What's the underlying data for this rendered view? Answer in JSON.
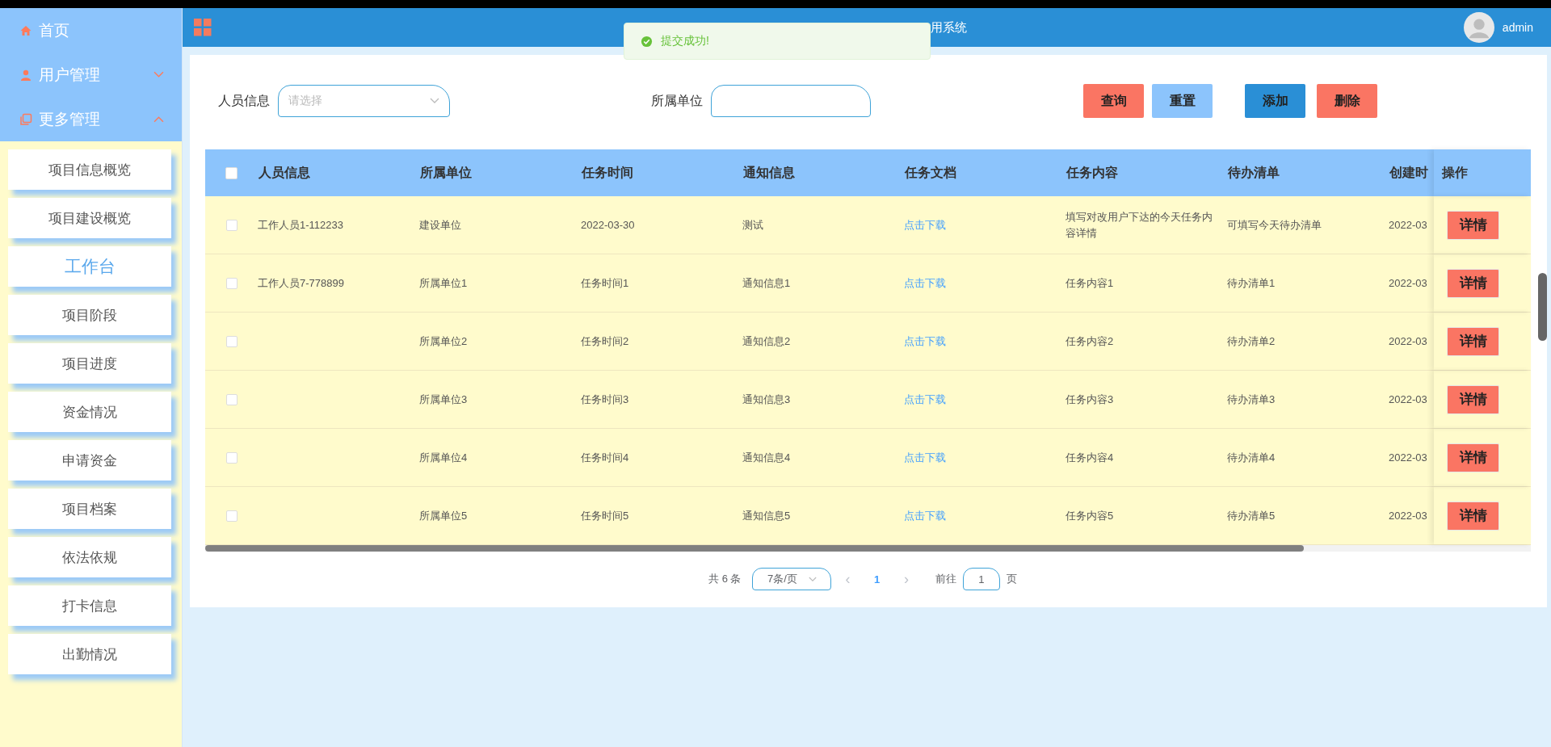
{
  "sidebar": {
    "menu": [
      {
        "label": "首页"
      },
      {
        "label": "用户管理",
        "expanded": false
      },
      {
        "label": "更多管理",
        "expanded": true
      }
    ],
    "submenu": [
      {
        "label": "项目信息概览",
        "selected": false
      },
      {
        "label": "项目建设概览",
        "selected": false
      },
      {
        "label": "工作台",
        "selected": true
      },
      {
        "label": "项目阶段",
        "selected": false
      },
      {
        "label": "项目进度",
        "selected": false
      },
      {
        "label": "资金情况",
        "selected": false
      },
      {
        "label": "申请资金",
        "selected": false
      },
      {
        "label": "项目档案",
        "selected": false
      },
      {
        "label": "依法依规",
        "selected": false
      },
      {
        "label": "打卡信息",
        "selected": false
      },
      {
        "label": "出勤情况",
        "selected": false
      }
    ]
  },
  "header": {
    "title": "用系统",
    "user": "admin"
  },
  "toast": {
    "message": "提交成功!"
  },
  "search": {
    "fields": [
      {
        "label": "人员信息",
        "kind": "select",
        "placeholder": "请选择"
      },
      {
        "label": "所属单位",
        "kind": "input"
      }
    ],
    "buttons": [
      {
        "label": "查询",
        "kind": "danger"
      },
      {
        "label": "重置",
        "kind": "light"
      },
      {
        "label": "添加",
        "kind": "primary"
      },
      {
        "label": "删除",
        "kind": "danger"
      }
    ]
  },
  "table": {
    "select_all_checked": false,
    "columns": [
      "人员信息",
      "所属单位",
      "任务时间",
      "通知信息",
      "任务文档",
      "任务内容",
      "待办清单",
      "创建时"
    ],
    "action_column": "操作",
    "rows": [
      {
        "checked": false,
        "cells": [
          "工作人员1-112233",
          "建设单位",
          "2022-03-30",
          "测试",
          "点击下载",
          "填写对改用户下达的今天任务内容详情",
          "可填写今天待办清单",
          "2022-03"
        ],
        "action": "详情"
      },
      {
        "checked": false,
        "cells": [
          "工作人员7-778899",
          "所属单位1",
          "任务时间1",
          "通知信息1",
          "点击下载",
          "任务内容1",
          "待办清单1",
          "2022-03"
        ],
        "action": "详情"
      },
      {
        "checked": false,
        "cells": [
          "",
          "所属单位2",
          "任务时间2",
          "通知信息2",
          "点击下载",
          "任务内容2",
          "待办清单2",
          "2022-03"
        ],
        "action": "详情"
      },
      {
        "checked": false,
        "cells": [
          "",
          "所属单位3",
          "任务时间3",
          "通知信息3",
          "点击下载",
          "任务内容3",
          "待办清单3",
          "2022-03"
        ],
        "action": "详情"
      },
      {
        "checked": false,
        "cells": [
          "",
          "所属单位4",
          "任务时间4",
          "通知信息4",
          "点击下载",
          "任务内容4",
          "待办清单4",
          "2022-03"
        ],
        "action": "详情"
      },
      {
        "checked": false,
        "cells": [
          "",
          "所属单位5",
          "任务时间5",
          "通知信息5",
          "点击下载",
          "任务内容5",
          "待办清单5",
          "2022-03"
        ],
        "action": "详情"
      }
    ]
  },
  "pagination": {
    "total": "共 6 条",
    "page_size": "7条/页",
    "prev": "‹",
    "pages": [
      {
        "label": "1",
        "selected": true
      }
    ],
    "next": "›",
    "goto_label": "前往",
    "goto_value": "1",
    "goto_suffix": "页"
  }
}
